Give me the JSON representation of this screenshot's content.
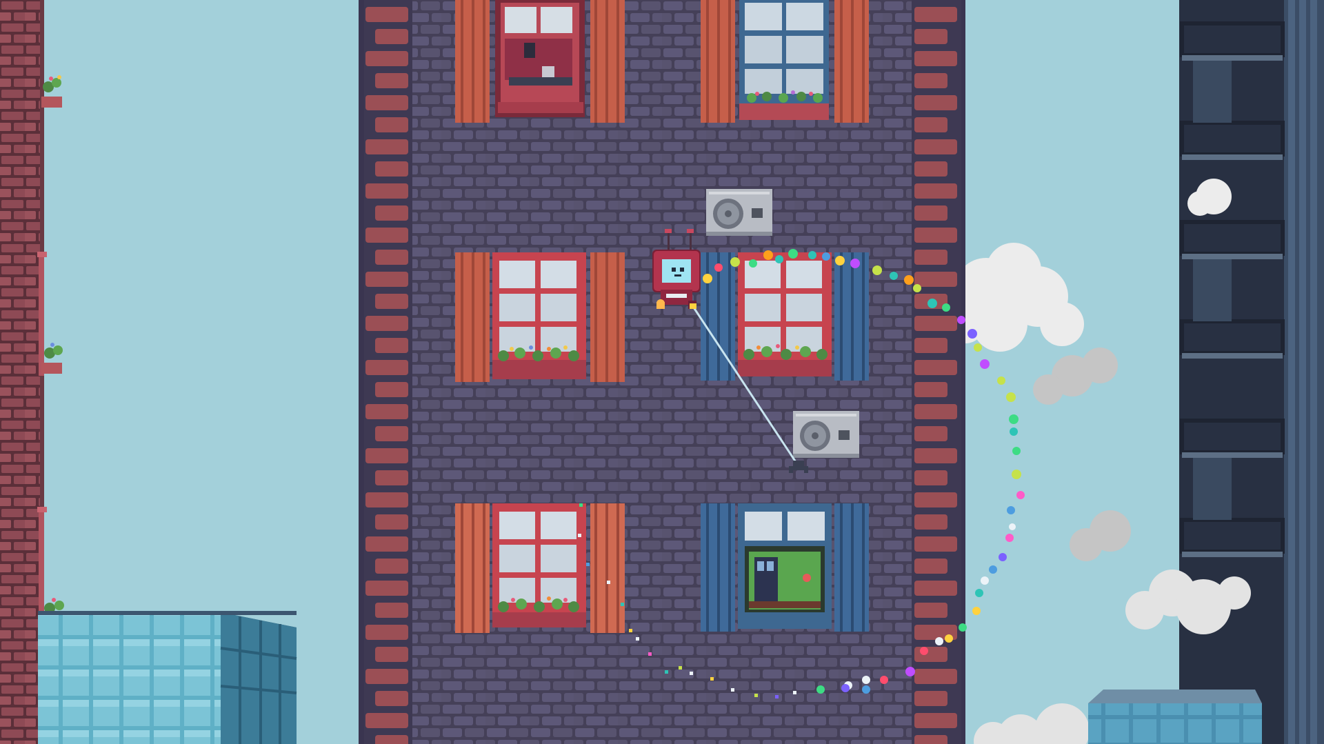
{
  "game": {
    "palette": {
      "sky": "#a3d0da",
      "wall": "#524d6a",
      "wall_brick": "#5d5878",
      "wall_mortar": "#403c55",
      "trim_brick": "#9b4f55",
      "trim_brick_light": "#b1616a",
      "shutter_orange": "#d06a52",
      "shutter_orange_dark": "#9f4738",
      "shutter_blue": "#3f6a9a",
      "shutter_blue_dark": "#2b4b72",
      "window_frame_red": "#c7444f",
      "window_frame_blue": "#3e6891",
      "glass": "#c8d6e0",
      "ac_unit": "#b8bcc4",
      "robot_body": "#b3344e",
      "robot_screen": "#8ad7e8",
      "rope": "#c8e4ef",
      "cloud": "#e8e8e8",
      "glass_building": "#6fb6c8",
      "fire_escape": "#2f3446"
    },
    "trail_colors": [
      "#ff4d6d",
      "#ff9f1c",
      "#c6e24a",
      "#3ddc84",
      "#2ec4b6",
      "#4d9de0",
      "#7b61ff",
      "#c04dff",
      "#ff5cc8",
      "#ffd23f"
    ],
    "player": {
      "icon": "robot-tv-head",
      "state": "swinging"
    },
    "grapple_anchor": {
      "icon": "ac-unit-hook"
    }
  }
}
